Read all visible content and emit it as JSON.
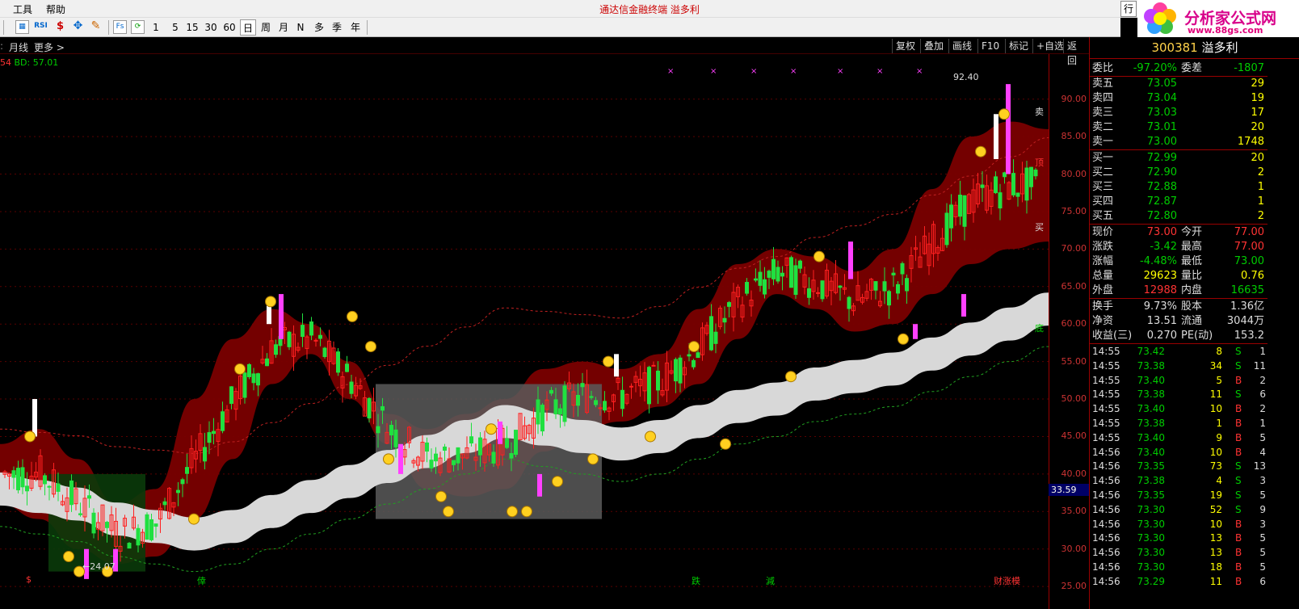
{
  "menu": {
    "tools": "工具",
    "help": "帮助"
  },
  "app_title": "通达信金融终端    溢多利",
  "side_tab": "行",
  "logo": {
    "name": "分析家公式网",
    "url": "www.88gs.com"
  },
  "toolbar": {
    "icons": [
      {
        "label": "Fs"
      },
      {
        "label": "RSI"
      },
      {
        "label": "$"
      },
      {
        "label": "✥"
      },
      {
        "label": "✎"
      }
    ],
    "periods": [
      "1",
      "5",
      "15",
      "30",
      "60",
      "日",
      "周",
      "月",
      "N",
      "多",
      "季",
      "年"
    ],
    "selected_period": "日"
  },
  "chart_header": {
    "left": [
      "月线",
      "更多 >"
    ],
    "buttons": [
      "复权",
      "叠加",
      "画线",
      "F10",
      "标记",
      "+自选",
      "返回"
    ]
  },
  "indicator": {
    "prefix": "54",
    "text": "BD: 57.01"
  },
  "chart_data": {
    "type": "line",
    "title": "",
    "y_range": [
      22,
      96
    ],
    "y_ticks": [
      "90.00",
      "85.00",
      "80.00",
      "75.00",
      "70.00",
      "65.00",
      "60.00",
      "55.00",
      "50.00",
      "45.00",
      "40.00",
      "35.00",
      "30.00",
      "25.00"
    ],
    "last_price_flag": "33.59",
    "high_label": "92.40",
    "low_label": "←24.07",
    "bottom_marks": [
      {
        "text": "$",
        "color": "#f33"
      },
      {
        "text": "倖",
        "color": "#0c0"
      },
      {
        "text": "跌",
        "color": "#0c0"
      },
      {
        "text": "減",
        "color": "#0c0"
      },
      {
        "text": "财涨模",
        "color": "#f33"
      }
    ],
    "side_marks": [
      {
        "text": "卖"
      },
      {
        "text": "顶"
      },
      {
        "text": "买"
      },
      {
        "text": "底"
      }
    ],
    "band_centers": [
      38,
      37,
      36,
      34,
      33,
      32,
      33,
      35,
      37,
      39,
      41,
      43,
      45,
      47,
      46,
      45,
      44,
      45,
      47,
      49,
      50,
      52,
      53,
      54,
      56,
      58,
      60,
      62
    ],
    "cloud_upper": [
      44,
      46,
      42,
      36,
      38,
      50,
      58,
      62,
      60,
      55,
      48,
      46,
      48,
      50,
      54,
      55,
      54,
      56,
      62,
      68,
      70,
      69,
      67,
      70,
      78,
      85,
      87,
      86
    ],
    "cloud_lower": [
      36,
      34,
      30,
      28,
      29,
      34,
      42,
      52,
      56,
      50,
      44,
      38,
      37,
      38,
      43,
      46,
      47,
      49,
      52,
      58,
      64,
      62,
      59,
      60,
      64,
      68,
      70,
      71
    ]
  },
  "stock": {
    "code": "300381",
    "name": "溢多利"
  },
  "quote": {
    "ratio": {
      "label": "委比",
      "value": "-97.20%",
      "label2": "委差",
      "value2": "-1807"
    },
    "asks": [
      {
        "label": "卖五",
        "price": "73.05",
        "vol": "29"
      },
      {
        "label": "卖四",
        "price": "73.04",
        "vol": "19"
      },
      {
        "label": "卖三",
        "price": "73.03",
        "vol": "17"
      },
      {
        "label": "卖二",
        "price": "73.01",
        "vol": "20"
      },
      {
        "label": "卖一",
        "price": "73.00",
        "vol": "1748"
      }
    ],
    "bids": [
      {
        "label": "买一",
        "price": "72.99",
        "vol": "20"
      },
      {
        "label": "买二",
        "price": "72.90",
        "vol": "2"
      },
      {
        "label": "买三",
        "price": "72.88",
        "vol": "1"
      },
      {
        "label": "买四",
        "price": "72.87",
        "vol": "1"
      },
      {
        "label": "买五",
        "price": "72.80",
        "vol": "2"
      }
    ],
    "stats": [
      {
        "l1": "现价",
        "v1": "73.00",
        "c1": "red",
        "l2": "今开",
        "v2": "77.00",
        "c2": "red"
      },
      {
        "l1": "涨跌",
        "v1": "-3.42",
        "c1": "green",
        "l2": "最高",
        "v2": "77.00",
        "c2": "red"
      },
      {
        "l1": "涨幅",
        "v1": "-4.48%",
        "c1": "green",
        "l2": "最低",
        "v2": "73.00",
        "c2": "green"
      },
      {
        "l1": "总量",
        "v1": "29623",
        "c1": "yellow",
        "l2": "量比",
        "v2": "0.76",
        "c2": "yellow"
      },
      {
        "l1": "外盘",
        "v1": "12988",
        "c1": "red",
        "l2": "内盘",
        "v2": "16635",
        "c2": "green"
      }
    ],
    "stats2": [
      {
        "l1": "换手",
        "v1": "9.73%",
        "l2": "股本",
        "v2": "1.36亿"
      },
      {
        "l1": "净资",
        "v1": "13.51",
        "l2": "流通",
        "v2": "3044万"
      },
      {
        "l1": "收益(三)",
        "v1": "0.270",
        "l2": "PE(动)",
        "v2": "153.2"
      }
    ]
  },
  "trades": [
    {
      "time": "14:55",
      "price": "73.42",
      "vol": "8",
      "side": "S",
      "n": "1"
    },
    {
      "time": "14:55",
      "price": "73.38",
      "vol": "34",
      "side": "S",
      "n": "11"
    },
    {
      "time": "14:55",
      "price": "73.40",
      "vol": "5",
      "side": "B",
      "n": "2"
    },
    {
      "time": "14:55",
      "price": "73.38",
      "vol": "11",
      "side": "S",
      "n": "6"
    },
    {
      "time": "14:55",
      "price": "73.40",
      "vol": "10",
      "side": "B",
      "n": "2"
    },
    {
      "time": "14:55",
      "price": "73.38",
      "vol": "1",
      "side": "B",
      "n": "1"
    },
    {
      "time": "14:55",
      "price": "73.40",
      "vol": "9",
      "side": "B",
      "n": "5"
    },
    {
      "time": "14:56",
      "price": "73.40",
      "vol": "10",
      "side": "B",
      "n": "4"
    },
    {
      "time": "14:56",
      "price": "73.35",
      "vol": "73",
      "side": "S",
      "n": "13"
    },
    {
      "time": "14:56",
      "price": "73.38",
      "vol": "4",
      "side": "S",
      "n": "3"
    },
    {
      "time": "14:56",
      "price": "73.35",
      "vol": "19",
      "side": "S",
      "n": "5"
    },
    {
      "time": "14:56",
      "price": "73.30",
      "vol": "52",
      "side": "S",
      "n": "9"
    },
    {
      "time": "14:56",
      "price": "73.30",
      "vol": "10",
      "side": "B",
      "n": "3"
    },
    {
      "time": "14:56",
      "price": "73.30",
      "vol": "13",
      "side": "B",
      "n": "5"
    },
    {
      "time": "14:56",
      "price": "73.30",
      "vol": "13",
      "side": "B",
      "n": "5"
    },
    {
      "time": "14:56",
      "price": "73.30",
      "vol": "18",
      "side": "B",
      "n": "5"
    },
    {
      "time": "14:56",
      "price": "73.29",
      "vol": "11",
      "side": "B",
      "n": "6"
    }
  ]
}
